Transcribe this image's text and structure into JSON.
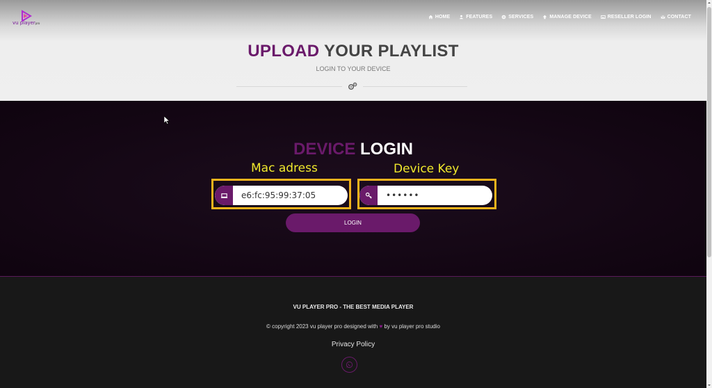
{
  "brand": {
    "logo_text": "vu player",
    "logo_suffix": "pro",
    "accent_color": "#6a1a6a",
    "annotation_color": "#f3b31c",
    "annotation_text_color": "#f1e92c"
  },
  "nav": {
    "items": [
      {
        "label": "HOME",
        "icon": "home-icon"
      },
      {
        "label": "FEATURES",
        "icon": "user-icon"
      },
      {
        "label": "SERVICES",
        "icon": "gear-icon"
      },
      {
        "label": "MANAGE DEVICE",
        "icon": "upload-icon"
      },
      {
        "label": "RESELLER LOGIN",
        "icon": "image-icon"
      },
      {
        "label": "CONTACT",
        "icon": "envelope-icon"
      }
    ]
  },
  "hero": {
    "title_part1": "UPLOAD",
    "title_part2": "YOUR PLAYLIST",
    "subtitle": "LOGIN TO YOUR DEVICE"
  },
  "login": {
    "title_part1": "DEVICE",
    "title_part2": "LOGIN",
    "mac_annotation": "Mac adress",
    "key_annotation": "Device Key",
    "mac_value": "e6:fc:95:99:37:05",
    "key_value": "••••••",
    "button_label": "LOGIN"
  },
  "footer": {
    "title": "VU PLAYER PRO - THE BEST MEDIA PLAYER",
    "copy_before": "© copyright 2023 vu player pro designed with",
    "heart": "♥",
    "copy_after": "by vu player pro studio",
    "privacy": "Privacy Policy"
  }
}
